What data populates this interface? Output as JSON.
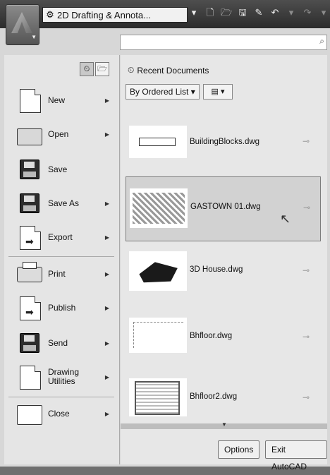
{
  "titlebar": {
    "workspace": "2D Drafting & Annota...",
    "qat_icons": [
      "new-icon",
      "open-icon",
      "save-icon",
      "saveas-icon",
      "undo-icon",
      "redo-icon",
      "plot-icon"
    ]
  },
  "search": {
    "placeholder": ""
  },
  "left_menu": {
    "items": [
      {
        "label": "New",
        "icon": "new-document-icon",
        "submenu": true
      },
      {
        "label": "Open",
        "icon": "open-folder-icon",
        "submenu": true
      },
      {
        "label": "Save",
        "icon": "save-icon",
        "submenu": false
      },
      {
        "label": "Save As",
        "icon": "save-as-icon",
        "submenu": true
      },
      {
        "label": "Export",
        "icon": "export-icon",
        "submenu": true
      },
      {
        "label": "Print",
        "icon": "printer-icon",
        "submenu": true
      },
      {
        "label": "Publish",
        "icon": "publish-icon",
        "submenu": true
      },
      {
        "label": "Send",
        "icon": "send-icon",
        "submenu": true
      },
      {
        "label": "Drawing\nUtilities",
        "icon": "drawing-utilities-icon",
        "submenu": true
      },
      {
        "label": "Close",
        "icon": "close-folder-icon",
        "submenu": true
      }
    ]
  },
  "recent": {
    "title": "Recent Documents",
    "order_label": "By Ordered List",
    "documents": [
      {
        "name": "BuildingBlocks.dwg",
        "selected": false
      },
      {
        "name": "GASTOWN 01.dwg",
        "selected": true
      },
      {
        "name": "3D House.dwg",
        "selected": false
      },
      {
        "name": "Bhfloor.dwg",
        "selected": false
      },
      {
        "name": "Bhfloor2.dwg",
        "selected": false
      }
    ]
  },
  "footer": {
    "options_label": "Options",
    "exit_label": "Exit AutoCAD"
  }
}
